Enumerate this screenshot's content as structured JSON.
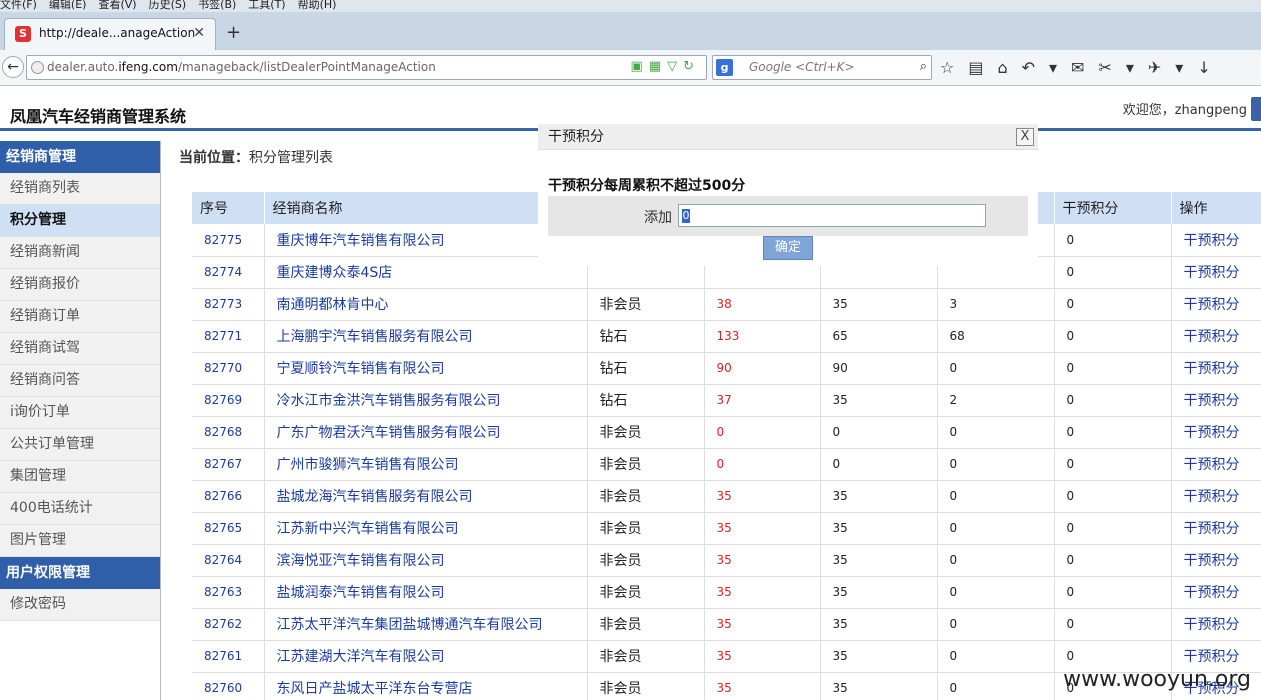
{
  "browser": {
    "menu": [
      "文件(F)",
      "编辑(E)",
      "查看(V)",
      "历史(S)",
      "书签(B)",
      "工具(T)",
      "帮助(H)"
    ],
    "tab_title": "http://deale...anageAction",
    "url_prefix": "dealer.auto.",
    "url_domain": "ifeng.com",
    "url_path": "/manageback/listDealerPointManageAction",
    "search_placeholder": "Google <Ctrl+K>"
  },
  "app": {
    "title": "凤凰汽车经销商管理系统",
    "welcome": "欢迎您，zhangpeng"
  },
  "sidebar": {
    "sections": [
      {
        "title": "经销商管理",
        "items": [
          "经销商列表",
          "积分管理",
          "经销商新闻",
          "经销商报价",
          "经销商订单",
          "经销商试驾",
          "经销商问答",
          "i询价订单",
          "公共订单管理",
          "集团管理",
          "400电话统计",
          "图片管理"
        ]
      },
      {
        "title": "用户权限管理",
        "items": [
          "修改密码"
        ]
      }
    ],
    "active_item": "积分管理"
  },
  "breadcrumb": {
    "label": "当前位置：",
    "value": "积分管理列表"
  },
  "table": {
    "headers": [
      "序号",
      "经销商名称",
      "",
      "",
      "",
      "",
      "干预积分",
      "操作"
    ],
    "rows": [
      [
        "82775",
        "重庆博年汽车销售有限公司",
        "",
        "",
        "",
        "",
        "0",
        "干预积分"
      ],
      [
        "82774",
        "重庆建博众泰4S店",
        "",
        "",
        "",
        "",
        "0",
        "干预积分"
      ],
      [
        "82773",
        "南通明都林肯中心",
        "非会员",
        "38",
        "35",
        "3",
        "0",
        "干预积分"
      ],
      [
        "82771",
        "上海鹏宇汽车销售服务有限公司",
        "钻石",
        "133",
        "65",
        "68",
        "0",
        "干预积分"
      ],
      [
        "82770",
        "宁夏顺铃汽车销售有限公司",
        "钻石",
        "90",
        "90",
        "0",
        "0",
        "干预积分"
      ],
      [
        "82769",
        "冷水江市金洪汽车销售服务有限公司",
        "钻石",
        "37",
        "35",
        "2",
        "0",
        "干预积分"
      ],
      [
        "82768",
        "广东广物君沃汽车销售服务有限公司",
        "非会员",
        "0",
        "0",
        "0",
        "0",
        "干预积分"
      ],
      [
        "82767",
        "广州市骏狮汽车销售有限公司",
        "非会员",
        "0",
        "0",
        "0",
        "0",
        "干预积分"
      ],
      [
        "82766",
        "盐城龙海汽车销售服务有限公司",
        "非会员",
        "35",
        "35",
        "0",
        "0",
        "干预积分"
      ],
      [
        "82765",
        "江苏新中兴汽车销售有限公司",
        "非会员",
        "35",
        "35",
        "0",
        "0",
        "干预积分"
      ],
      [
        "82764",
        "滨海悦亚汽车销售有限公司",
        "非会员",
        "35",
        "35",
        "0",
        "0",
        "干预积分"
      ],
      [
        "82763",
        "盐城润泰汽车销售有限公司",
        "非会员",
        "35",
        "35",
        "0",
        "0",
        "干预积分"
      ],
      [
        "82762",
        "江苏太平洋汽车集团盐城博通汽车有限公司",
        "非会员",
        "35",
        "35",
        "0",
        "0",
        "干预积分"
      ],
      [
        "82761",
        "江苏建湖大洋汽车有限公司",
        "非会员",
        "35",
        "35",
        "0",
        "0",
        "干预积分"
      ],
      [
        "82760",
        "东风日产盐城太平洋东台专营店",
        "非会员",
        "35",
        "35",
        "0",
        "0",
        "干预积分"
      ]
    ]
  },
  "modal": {
    "title": "干预积分",
    "close_label": "X",
    "note": "干预积分每周累积不超过500分",
    "field_label": "添加",
    "field_value": "0",
    "confirm_label": "确定"
  },
  "watermark": "www.wooyun.org",
  "colors": {
    "accent": "#2f5fa8",
    "header_cell": "#cfe0f5",
    "link": "#1a3ca0",
    "points_red": "#d22222"
  }
}
